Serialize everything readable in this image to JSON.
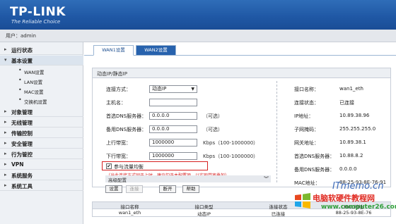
{
  "header": {
    "logo": "TP-LINK",
    "tagline": "The Reliable Choice"
  },
  "userbar": {
    "text": "用户：admin"
  },
  "sidebar": {
    "items": [
      {
        "label": "运行状态",
        "icon": "arrow-right-icon"
      },
      {
        "label": "基本设置",
        "icon": "arrow-down-icon"
      },
      {
        "label": "对象管理",
        "icon": "arrow-right-icon"
      },
      {
        "label": "无线管理",
        "icon": "arrow-right-icon"
      },
      {
        "label": "传输控制",
        "icon": "arrow-right-icon"
      },
      {
        "label": "安全管理",
        "icon": "arrow-right-icon"
      },
      {
        "label": "行为管控",
        "icon": "arrow-right-icon"
      },
      {
        "label": "VPN",
        "icon": "arrow-right-icon"
      },
      {
        "label": "系统服务",
        "icon": "arrow-right-icon"
      },
      {
        "label": "系统工具",
        "icon": "arrow-right-icon"
      }
    ],
    "subitems": [
      {
        "label": "WAN设置"
      },
      {
        "label": "LAN设置"
      },
      {
        "label": "MAC设置"
      },
      {
        "label": "交换机设置"
      }
    ]
  },
  "tabs": [
    {
      "label": "WAN1设置"
    },
    {
      "label": "WAN2设置"
    }
  ],
  "panel": {
    "title": "动态IP/静态IP",
    "form": {
      "connection_label": "连接方式：",
      "connection_value": "动态IP",
      "hostname_label": "主机名：",
      "hostname_value": "",
      "dns1_label": "首选DNS服务器：",
      "dns1_value": "0.0.0.0",
      "dns1_hint": "（可选）",
      "dns2_label": "备用DNS服务器：",
      "dns2_value": "0.0.0.0",
      "dns2_hint": "（可选）",
      "up_label": "上行带宽：",
      "up_value": "1000000",
      "up_hint": "Kbps（100-1000000）",
      "down_label": "下行带宽：",
      "down_value": "1000000",
      "down_hint": "Kbps（100-1000000）",
      "balance_label": "参与流量均衡",
      "balance_checked": "✔",
      "balance_note": "（当此连接方式同于上时，建议勾选本配置项，以实现带宽叠加）"
    },
    "advanced_label": "高级配置",
    "buttons": {
      "set": "设置",
      "connect": "连接",
      "disconnect": "断开",
      "help": "帮助"
    },
    "info": [
      {
        "label": "接口名称：",
        "value": "wan1_eth"
      },
      {
        "label": "连接状态：",
        "value": "已连接"
      },
      {
        "label": "IP地址：",
        "value": "10.89.38.96"
      },
      {
        "label": "子网掩码：",
        "value": "255.255.255.0"
      },
      {
        "label": "网关地址：",
        "value": "10.89.38.1"
      },
      {
        "label": "首选DNS服务器：",
        "value": "10.88.8.2"
      },
      {
        "label": "备用DNS服务器：",
        "value": "0.0.0.0"
      },
      {
        "label": "MAC地址：",
        "value": "88-25-93-8E-76-91"
      }
    ]
  },
  "table": {
    "headers": [
      "接口名称",
      "接口类型",
      "连接状态",
      "MAC地址"
    ],
    "rows": [
      [
        "wan1_eth",
        "动态IP",
        "已连接",
        "88-25-93-8E-76"
      ]
    ]
  },
  "watermark": {
    "brand": "ITmemo.cn",
    "cn": "电脑软硬件教程网",
    "url": "www.computer26.com"
  }
}
